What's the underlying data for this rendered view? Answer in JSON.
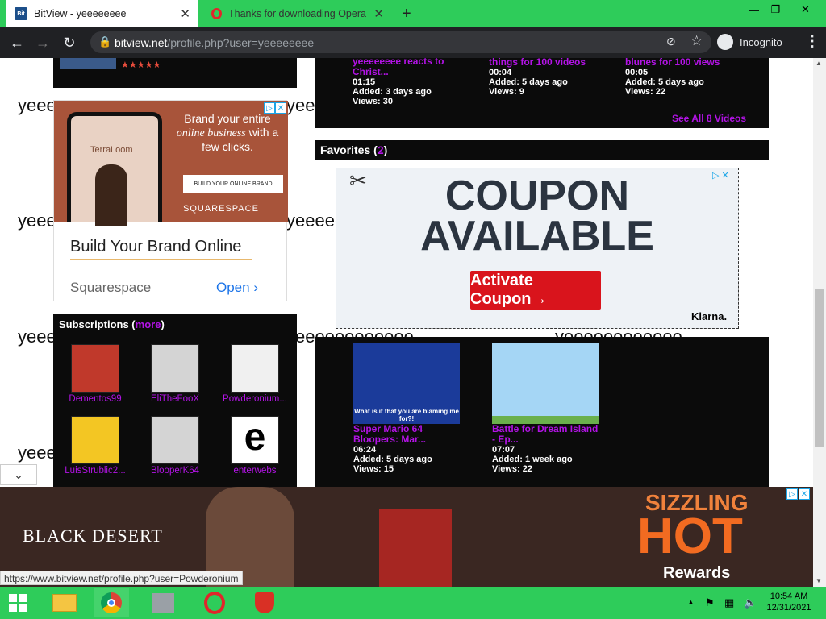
{
  "tabs": [
    {
      "title": "BitView - yeeeeeeee",
      "active": true
    },
    {
      "title": "Thanks for downloading Opera",
      "active": false
    }
  ],
  "window_controls": {
    "minimize": "—",
    "restore": "❐",
    "close": "✕"
  },
  "address": {
    "domain": "bitview.net",
    "path": "/profile.php?user=yeeeeeeee"
  },
  "incognito_label": "Incognito",
  "bg_word": "yeeeeeeeeeeee",
  "videos_top": [
    {
      "title": "yeeeeeeee reacts to Christ...",
      "duration": "01:15",
      "added": "Added: 3 days ago",
      "views": "Views: 30"
    },
    {
      "title": "things for 100 videos",
      "duration": "00:04",
      "added": "Added: 5 days ago",
      "views": "Views: 9"
    },
    {
      "title": "blunes for 100 views",
      "duration": "00:05",
      "added": "Added: 5 days ago",
      "views": "Views: 22"
    }
  ],
  "see_all": "See All 8 Videos",
  "favorites": {
    "label": "Favorites",
    "count": "2"
  },
  "coupon_ad": {
    "line1": "COUPON",
    "line2": "AVAILABLE",
    "button": "Activate Coupon→",
    "brand": "Klarna."
  },
  "squarespace_ad": {
    "headline": "Brand your entire",
    "headline2": "online business",
    "headline3": "with a few clicks.",
    "phone_brand": "TerraLoom",
    "phone_btn": "BUILD YOUR ONLINE BRAND",
    "logo": "SQUARESPACE",
    "title": "Build Your Brand Online",
    "advertiser": "Squarespace",
    "cta": "Open"
  },
  "subscriptions": {
    "label": "Subscriptions",
    "more": "more",
    "items": [
      "Dementos99",
      "EliTheFooX",
      "Powderonium...",
      "LuisStrublic2...",
      "BlooperK64",
      "enterwebs"
    ]
  },
  "favorite_videos": [
    {
      "thumb_caption": "What is it that you are blaming me for?!",
      "title": "Super Mario 64 Bloopers: Mar...",
      "duration": "06:24",
      "added": "Added: 5 days ago",
      "views": "Views: 15"
    },
    {
      "title": "Battle for Dream Island - Ep...",
      "duration": "07:07",
      "added": "Added: 1 week ago",
      "views": "Views: 22"
    }
  ],
  "bottom_ad": {
    "brand": "BLACK DESERT",
    "hot1": "SIZZLING",
    "hot2": "HOT",
    "hot3": "Rewards"
  },
  "status_url": "https://www.bitview.net/profile.php?user=Powderonium",
  "clock": {
    "time": "10:54 AM",
    "date": "12/31/2021"
  },
  "colors": {
    "accent_green": "#2ecc5a",
    "link_purple": "#b313e6",
    "chrome_dark": "#202124"
  }
}
